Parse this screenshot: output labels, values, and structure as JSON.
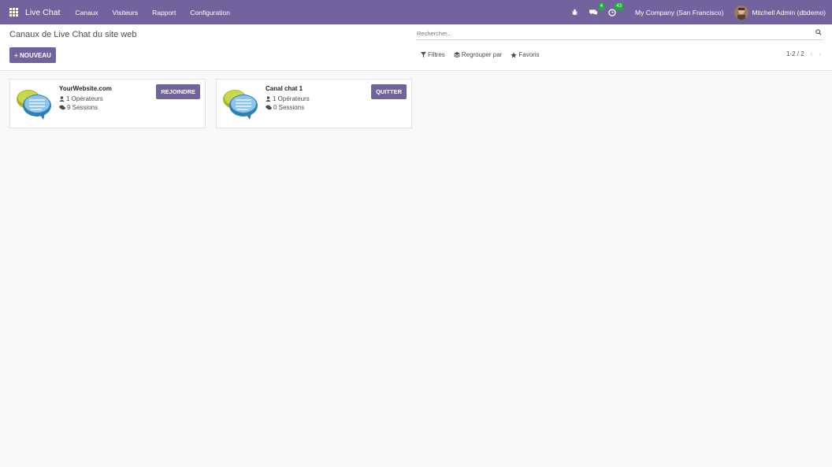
{
  "navbar": {
    "app_name": "Live Chat",
    "menu": [
      "Canaux",
      "Visiteurs",
      "Rapport",
      "Configuration"
    ],
    "icons": [
      "apps-grid-icon",
      "bug-icon",
      "messaging-icon",
      "activity-clock-icon"
    ],
    "messages_count": "4",
    "activities_count": "43",
    "company": "My Company (San Francisco)",
    "user": "Mitchell Admin (dbdemo)"
  },
  "control_panel": {
    "title": "Canaux de Live Chat du site web",
    "new_button": "+ NOUVEAU",
    "search_placeholder": "Rechercher...",
    "filters_label": "Filtres",
    "group_by_label": "Regrouper par",
    "favorites_label": "Favoris",
    "pager": "1-2 / 2"
  },
  "cards": [
    {
      "name": "YourWebsite.com",
      "operators": "1 Opérateurs",
      "sessions": "9 Sessions",
      "action": "REJOINDRE"
    },
    {
      "name": "Canal chat 1",
      "operators": "1 Opérateurs",
      "sessions": "0 Sessions",
      "action": "QUITTER"
    }
  ],
  "colors": {
    "brand": "#71639e",
    "badge": "#28a745"
  }
}
